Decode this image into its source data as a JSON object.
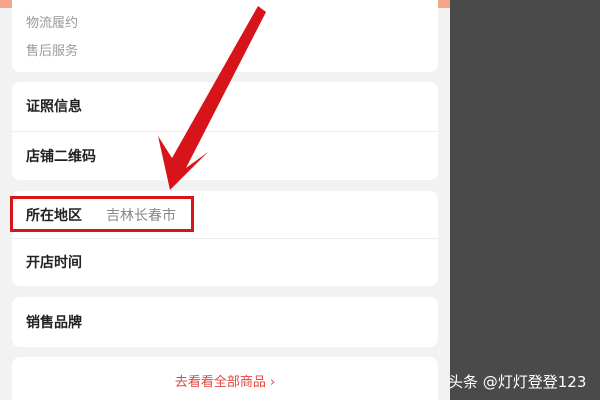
{
  "store_info": {
    "logistics": "物流履约",
    "after_sales": "售后服务",
    "license_info": "证照信息",
    "store_qr_code": "店铺二维码",
    "region_label": "所在地区",
    "region_value": "吉林长春市",
    "open_time_label": "开店时间",
    "brand_label": "销售品牌",
    "see_all_label": "去看看全部商品 ›"
  },
  "watermark": {
    "text": "头条 @灯灯登登123"
  },
  "colors": {
    "accent_red": "#d7141a",
    "link_red": "#e8453c",
    "label_dark": "#222222",
    "value_gray": "#888888",
    "background": "#f2f2f2",
    "side_pane": "#4a4a4a"
  }
}
